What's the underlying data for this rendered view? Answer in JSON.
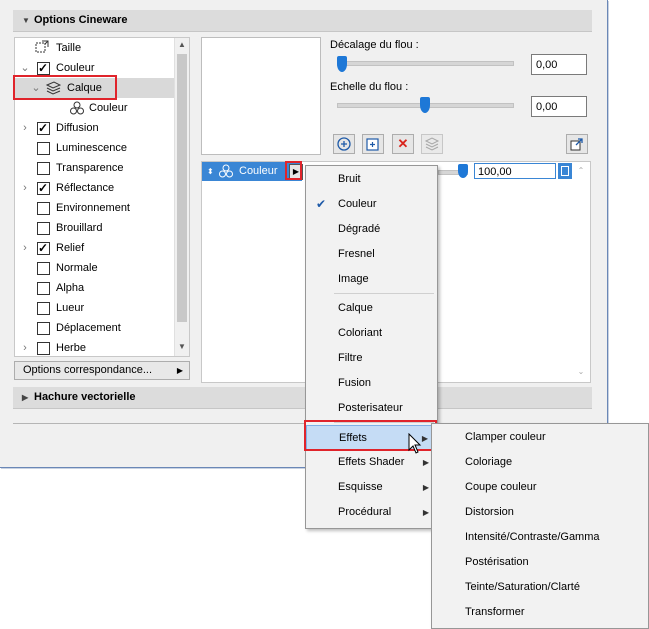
{
  "section": {
    "title": "Options Cineware",
    "hatching": "Hachure vectorielle"
  },
  "tree": {
    "items": [
      {
        "label": "Taille"
      },
      {
        "label": "Couleur"
      },
      {
        "label": "Calque"
      },
      {
        "label": "Couleur"
      },
      {
        "label": "Diffusion"
      },
      {
        "label": "Luminescence"
      },
      {
        "label": "Transparence"
      },
      {
        "label": "Réflectance"
      },
      {
        "label": "Environnement"
      },
      {
        "label": "Brouillard"
      },
      {
        "label": "Relief"
      },
      {
        "label": "Normale"
      },
      {
        "label": "Alpha"
      },
      {
        "label": "Lueur"
      },
      {
        "label": "Déplacement"
      },
      {
        "label": "Herbe"
      }
    ],
    "options_button": "Options correspondance..."
  },
  "blur": {
    "offset_label": "Décalage du flou :",
    "offset_value": "0,00",
    "scale_label": "Echelle du flou :",
    "scale_value": "0,00"
  },
  "layer": {
    "name": "Couleur",
    "value": "100,00"
  },
  "menu": {
    "items": [
      {
        "label": "Bruit"
      },
      {
        "label": "Couleur",
        "checked": true
      },
      {
        "label": "Dégradé"
      },
      {
        "label": "Fresnel"
      },
      {
        "label": "Image"
      },
      {
        "label": "Calque"
      },
      {
        "label": "Coloriant"
      },
      {
        "label": "Filtre"
      },
      {
        "label": "Fusion"
      },
      {
        "label": "Posterisateur"
      },
      {
        "label": "Effets"
      },
      {
        "label": "Effets Shader"
      },
      {
        "label": "Esquisse"
      },
      {
        "label": "Procédural"
      }
    ]
  },
  "submenu": {
    "items": [
      {
        "label": "Clamper couleur"
      },
      {
        "label": "Coloriage"
      },
      {
        "label": "Coupe couleur"
      },
      {
        "label": "Distorsion"
      },
      {
        "label": "Intensité/Contraste/Gamma"
      },
      {
        "label": "Postérisation"
      },
      {
        "label": "Teinte/Saturation/Clarté"
      },
      {
        "label": "Transformer"
      }
    ]
  },
  "colors": {
    "accent": "#3a86d5",
    "highlight": "#e0242b",
    "selected": "#c5dcf5"
  }
}
